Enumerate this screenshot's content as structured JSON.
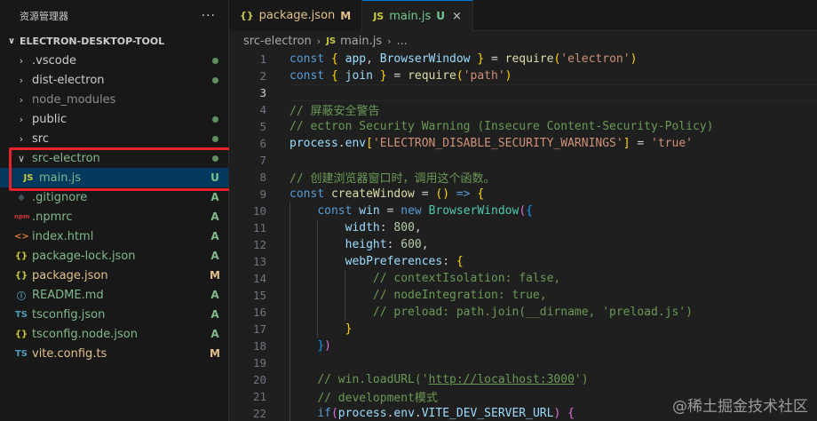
{
  "explorer": {
    "title": "资源管理器",
    "more": "···",
    "project": "ELECTRON-DESKTOP-TOOL",
    "items": [
      {
        "name": ".vscode",
        "type": "folder",
        "status": "dot",
        "color": "c-folder"
      },
      {
        "name": "dist-electron",
        "type": "folder",
        "status": "dot",
        "color": "c-folder"
      },
      {
        "name": "node_modules",
        "type": "folder",
        "status": "",
        "color": "c-dim"
      },
      {
        "name": "public",
        "type": "folder",
        "status": "dot",
        "color": "c-folder"
      },
      {
        "name": "src",
        "type": "folder",
        "status": "dot",
        "color": "c-folder"
      },
      {
        "name": "src-electron",
        "type": "folder-open",
        "status": "dot",
        "color": "c-git"
      },
      {
        "name": "main.js",
        "type": "js",
        "status": "U",
        "color": "c-git",
        "child": true,
        "active": true
      },
      {
        "name": ".gitignore",
        "type": "git",
        "status": "A",
        "color": "c-git"
      },
      {
        "name": ".npmrc",
        "type": "npm",
        "status": "A",
        "color": "c-git"
      },
      {
        "name": "index.html",
        "type": "html",
        "status": "A",
        "color": "c-git"
      },
      {
        "name": "package-lock.json",
        "type": "json",
        "status": "A",
        "color": "c-git"
      },
      {
        "name": "package.json",
        "type": "json",
        "status": "M",
        "color": "c-mod"
      },
      {
        "name": "README.md",
        "type": "info",
        "status": "A",
        "color": "c-git"
      },
      {
        "name": "tsconfig.json",
        "type": "ts",
        "status": "A",
        "color": "c-git"
      },
      {
        "name": "tsconfig.node.json",
        "type": "json",
        "status": "A",
        "color": "c-git"
      },
      {
        "name": "vite.config.ts",
        "type": "ts",
        "status": "M",
        "color": "c-mod"
      }
    ]
  },
  "tabs": [
    {
      "icon": "{}",
      "name": "package.json",
      "status": "M",
      "active": false
    },
    {
      "icon": "JS",
      "name": "main.js",
      "status": "U",
      "active": true,
      "close": "×"
    }
  ],
  "breadcrumb": {
    "folder": "src-electron",
    "icon": "JS",
    "file": "main.js",
    "tail": "..."
  },
  "code_lines": [
    {
      "n": "1",
      "html": "<span class='kw'>const</span> <span class='p1'>{</span> <span class='var'>app</span>, <span class='var'>BrowserWindow</span> <span class='p1'>}</span> = <span class='fn'>require</span><span class='p1'>(</span><span class='str'>'electron'</span><span class='p1'>)</span>"
    },
    {
      "n": "2",
      "html": "<span class='kw'>const</span> <span class='p1'>{</span> <span class='var'>join</span> <span class='p1'>}</span> = <span class='fn'>require</span><span class='p1'>(</span><span class='str'>'path'</span><span class='p1'>)</span>"
    },
    {
      "n": "3",
      "html": "",
      "current": true
    },
    {
      "n": "4",
      "html": "<span class='cm'>// 屏蔽安全警告</span>"
    },
    {
      "n": "5",
      "html": "<span class='cm'>// ectron Security Warning (Insecure Content-Security-Policy)</span>"
    },
    {
      "n": "6",
      "html": "<span class='var'>process</span>.<span class='var'>env</span><span class='p1'>[</span><span class='str'>'ELECTRON_DISABLE_SECURITY_WARNINGS'</span><span class='p1'>]</span> = <span class='str'>'true'</span>"
    },
    {
      "n": "7",
      "html": ""
    },
    {
      "n": "8",
      "html": "<span class='cm'>// 创建浏览器窗口时，调用这个函数。</span>"
    },
    {
      "n": "9",
      "html": "<span class='kw'>const</span> <span class='fn'>createWindow</span> = <span class='p1'>()</span> <span class='kw'>=&gt;</span> <span class='p1'>{</span>"
    },
    {
      "n": "10",
      "html": "    <span class='kw'>const</span> <span class='var'>win</span> = <span class='kw'>new</span> <span class='cls'>BrowserWindow</span><span class='p2'>(</span><span class='p3'>{</span>"
    },
    {
      "n": "11",
      "html": "        <span class='var'>width</span>: <span class='num'>800</span>,"
    },
    {
      "n": "12",
      "html": "        <span class='var'>height</span>: <span class='num'>600</span>,"
    },
    {
      "n": "13",
      "html": "        <span class='var'>webPreferences</span>: <span class='p1'>{</span>"
    },
    {
      "n": "14",
      "html": "            <span class='cm'>// contextIsolation: false,</span>"
    },
    {
      "n": "15",
      "html": "            <span class='cm'>// nodeIntegration: true,</span>"
    },
    {
      "n": "16",
      "html": "            <span class='cm'>// preload: path.join(__dirname, 'preload.js')</span>"
    },
    {
      "n": "17",
      "html": "        <span class='p1'>}</span>"
    },
    {
      "n": "18",
      "html": "    <span class='p3'>}</span><span class='p2'>)</span>"
    },
    {
      "n": "19",
      "html": ""
    },
    {
      "n": "20",
      "html": "    <span class='cm'>// win.loadURL('<u>http://localhost:3000</u>')</span>"
    },
    {
      "n": "21",
      "html": "    <span class='cm'>// development模式</span>"
    },
    {
      "n": "22",
      "html": "    <span class='kw'>if</span><span class='p2'>(</span><span class='var'>process</span>.<span class='var'>env</span>.<span class='var'>VITE_DEV_SERVER_URL</span><span class='p2'>)</span> <span class='p2'>{</span>"
    }
  ],
  "watermark": "@稀土掘金技术社区"
}
